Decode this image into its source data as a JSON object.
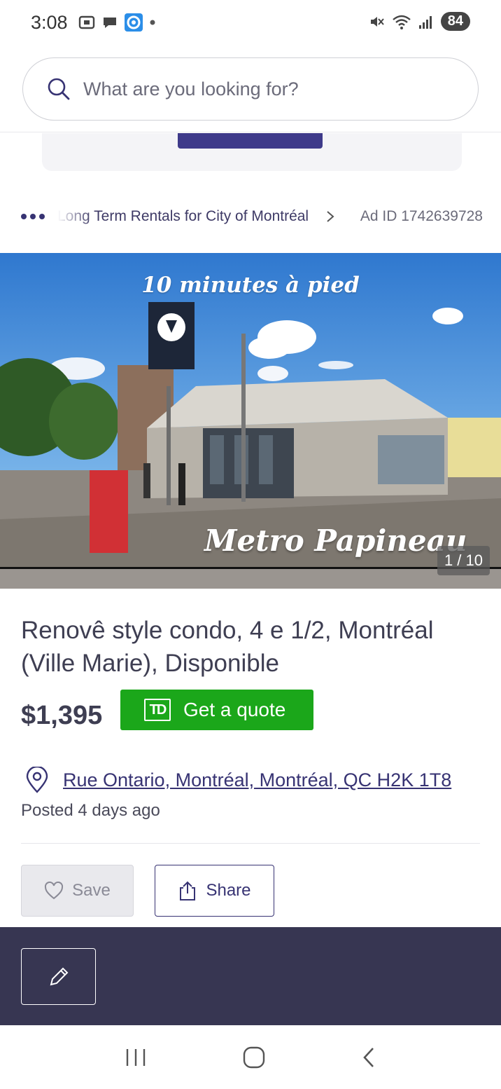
{
  "status_bar": {
    "time": "3:08",
    "battery": "84"
  },
  "search": {
    "placeholder": "What are you looking for?"
  },
  "breadcrumb": {
    "text": "Long Term Rentals for City of Montréal",
    "ad_id": "Ad ID 1742639728"
  },
  "hero": {
    "caption_top": "10 minutes à pied",
    "caption_bottom": "Metro Papineau",
    "sign_text": "METRO",
    "counter": "1 / 10"
  },
  "listing": {
    "title": "Renovê style condo, 4 e 1/2, Montréal (Ville Marie), Disponible",
    "price": "$1,395",
    "quote_button": "Get a quote",
    "quote_logo": "TD",
    "address": "Rue Ontario, Montréal, Montréal, QC H2K 1T8",
    "posted": "Posted 4 days ago"
  },
  "actions": {
    "save_label": "Save",
    "share_label": "Share"
  },
  "colors": {
    "brand": "#373373",
    "quote_green": "#1ba71a",
    "dark_panel": "#373652"
  },
  "icons": [
    "search-icon",
    "location-pin-icon",
    "heart-icon",
    "share-icon",
    "pencil-icon",
    "chevron-right-icon",
    "recents-icon",
    "home-icon",
    "back-icon"
  ]
}
